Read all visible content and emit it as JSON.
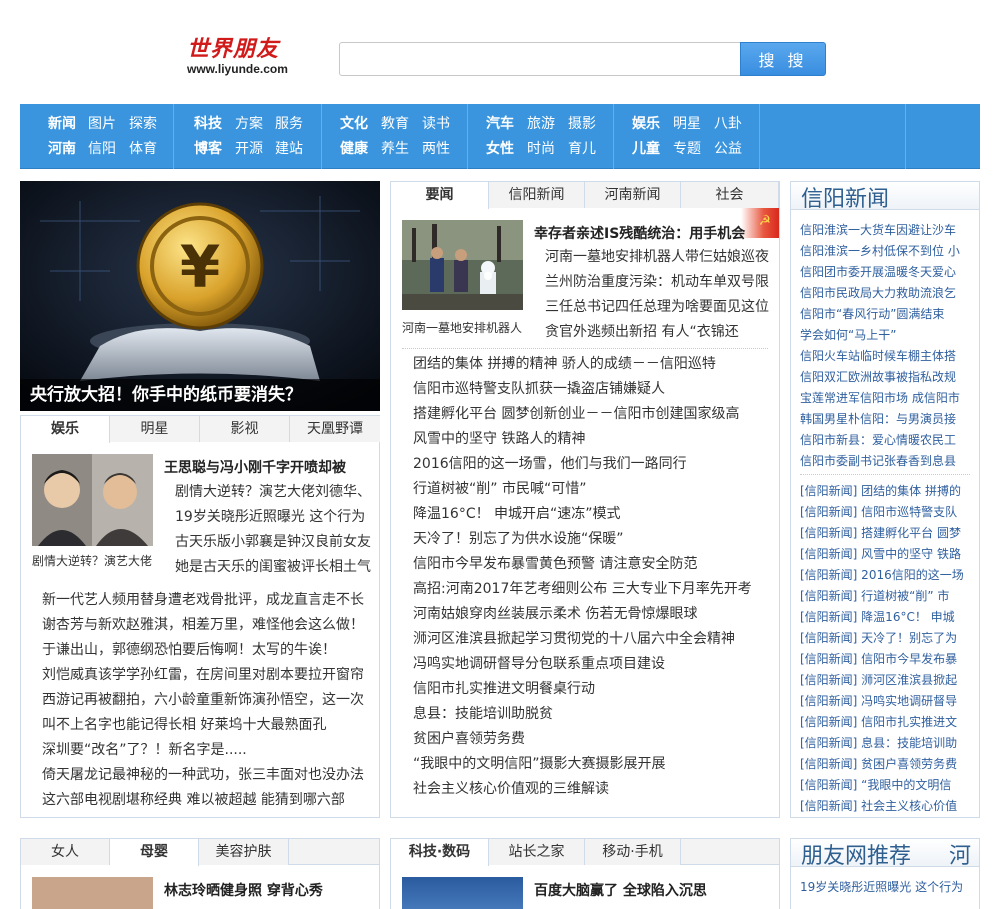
{
  "header": {
    "logo_cn": "世界朋友",
    "logo_url": "www.liyunde.com",
    "search_placeholder": "",
    "search_button": "搜 搜"
  },
  "nav": [
    {
      "r1": [
        "新闻",
        "图片",
        "探索"
      ],
      "r2": [
        "河南",
        "信阳",
        "体育"
      ]
    },
    {
      "r1": [
        "科技",
        "方案",
        "服务"
      ],
      "r2": [
        "博客",
        "开源",
        "建站"
      ]
    },
    {
      "r1": [
        "文化",
        "教育",
        "读书"
      ],
      "r2": [
        "健康",
        "养生",
        "两性"
      ]
    },
    {
      "r1": [
        "汽车",
        "旅游",
        "摄影"
      ],
      "r2": [
        "女性",
        "时尚",
        "育儿"
      ]
    },
    {
      "r1": [
        "娱乐",
        "明星",
        "八卦"
      ],
      "r2": [
        "儿童",
        "专题",
        "公益"
      ]
    }
  ],
  "banner": {
    "caption": "央行放大招！你手中的纸币要消失？"
  },
  "ent": {
    "tabs": [
      "娱乐",
      "明星",
      "影视",
      "天凰野谭"
    ],
    "headline": "王思聪与冯小刚千字开喷却被",
    "thumb_caption": "剧情大逆转？演艺大佬",
    "summary": [
      "剧情大逆转？演艺大佬刘德华、",
      "19岁关晓彤近照曝光 这个行为",
      "古天乐版小郭襄是钟汉良前女友",
      "她是古天乐的闺蜜被评长相土气"
    ],
    "list": [
      "新一代艺人频用替身遭老戏骨批评，成龙直言走不长",
      "谢杏芳与新欢赵雅淇，相差万里，难怪他会这么做！",
      "于谦出山，郭德纲恐怕要后悔啊！太写的牛诶！",
      "刘恺威真该学学孙红雷，在房间里对剧本要拉开窗帘",
      "西游记再被翻拍，六小龄童重新饰演孙悟空，这一次",
      "叫不上名字也能记得长相 好莱坞十大最熟面孔",
      "深圳要“改名”了？！新名字是.....",
      "倚天屠龙记最神秘的一种武功，张三丰面对也没办法",
      "这六部电视剧堪称经典 难以被超越 能猜到哪六部"
    ]
  },
  "news": {
    "tabs": [
      "要闻",
      "信阳新闻",
      "河南新闻",
      "社会"
    ],
    "headline": "幸存者亲述IS残酷统治：用手机会",
    "thumb_caption": "河南一墓地安排机器人",
    "summary": [
      "河南一墓地安排机器人带仨姑娘巡夜",
      "兰州防治重度污染：机动车单双号限",
      "三任总书记四任总理为啥要面见这位",
      "贪官外逃频出新招 有人“衣锦还"
    ],
    "list": [
      "团结的集体 拼搏的精神 骄人的成绩－－信阳巡特",
      "信阳市巡特警支队抓获一撬盗店铺嫌疑人",
      "搭建孵化平台 圆梦创新创业－－信阳市创建国家级高",
      "风雪中的坚守 铁路人的精神",
      "2016信阳的这一场雪，他们与我们一路同行",
      "行道树被“削” 市民喊“可惜”",
      "降温16°C！ 申城开启“速冻”模式",
      "天冷了！别忘了为供水设施“保暖”",
      "信阳市今早发布暴雪黄色预警 请注意安全防范",
      "高招:河南2017年艺考细则公布 三大专业下月率先开考",
      "河南姑娘穿肉丝装展示柔术 伤若无骨惊爆眼球",
      "浉河区淮滨县掀起学习贯彻党的十八届六中全会精神",
      "冯鸣实地调研督导分包联系重点项目建设",
      "信阳市扎实推进文明餐桌行动",
      "息县：技能培训助脱贫",
      "贫困户喜领劳务费",
      "“我眼中的文明信阳”摄影大赛摄影展开展",
      "社会主义核心价值观的三维解读"
    ]
  },
  "xinyang": {
    "title": "信阳新闻",
    "list1": [
      "信阳淮滨一大货车因避让沙车",
      "信阳淮滨一乡村低保不到位 小",
      "信阳团市委开展温暖冬天爱心",
      "信阳市民政局大力救助流浪乞",
      "信阳市“春风行动”圆满结束",
      "学会如何“马上干”",
      "信阳火车站临时候车棚主体搭",
      "信阳双汇欧洲故事被指私改规",
      "宝莲常进军信阳市场 成信阳市",
      "韩国男星朴信阳：与男演员接",
      "信阳市新县：爱心情暖农民工",
      "信阳市委副书记张春香到息县"
    ],
    "list2": [
      "[信阳新闻] 团结的集体 拼搏的",
      "[信阳新闻] 信阳市巡特警支队",
      "[信阳新闻] 搭建孵化平台 圆梦",
      "[信阳新闻] 风雪中的坚守 铁路",
      "[信阳新闻] 2016信阳的这一场",
      "[信阳新闻] 行道树被“削” 市",
      "[信阳新闻] 降温16°C！ 申城",
      "[信阳新闻] 天冷了！别忘了为",
      "[信阳新闻] 信阳市今早发布暴",
      "[信阳新闻] 浉河区淮滨县掀起",
      "[信阳新闻] 冯鸣实地调研督导",
      "[信阳新闻] 信阳市扎实推进文",
      "[信阳新闻] 息县：技能培训助",
      "[信阳新闻] 贫困户喜领劳务费",
      "[信阳新闻] “我眼中的文明信",
      "[信阳新闻] 社会主义核心价值"
    ]
  },
  "women": {
    "tabs": [
      "女人",
      "母婴",
      "美容护肤"
    ],
    "headline": "林志玲晒健身照 穿背心秀"
  },
  "tech": {
    "tabs": [
      "科技·数码",
      "站长之家",
      "移动·手机"
    ],
    "headline": "百度大脑赢了 全球陷入沉思"
  },
  "recommend": {
    "title": "朋友网推荐",
    "title_extra": "河",
    "line1": "19岁关晓彤近照曝光 这个行为"
  }
}
